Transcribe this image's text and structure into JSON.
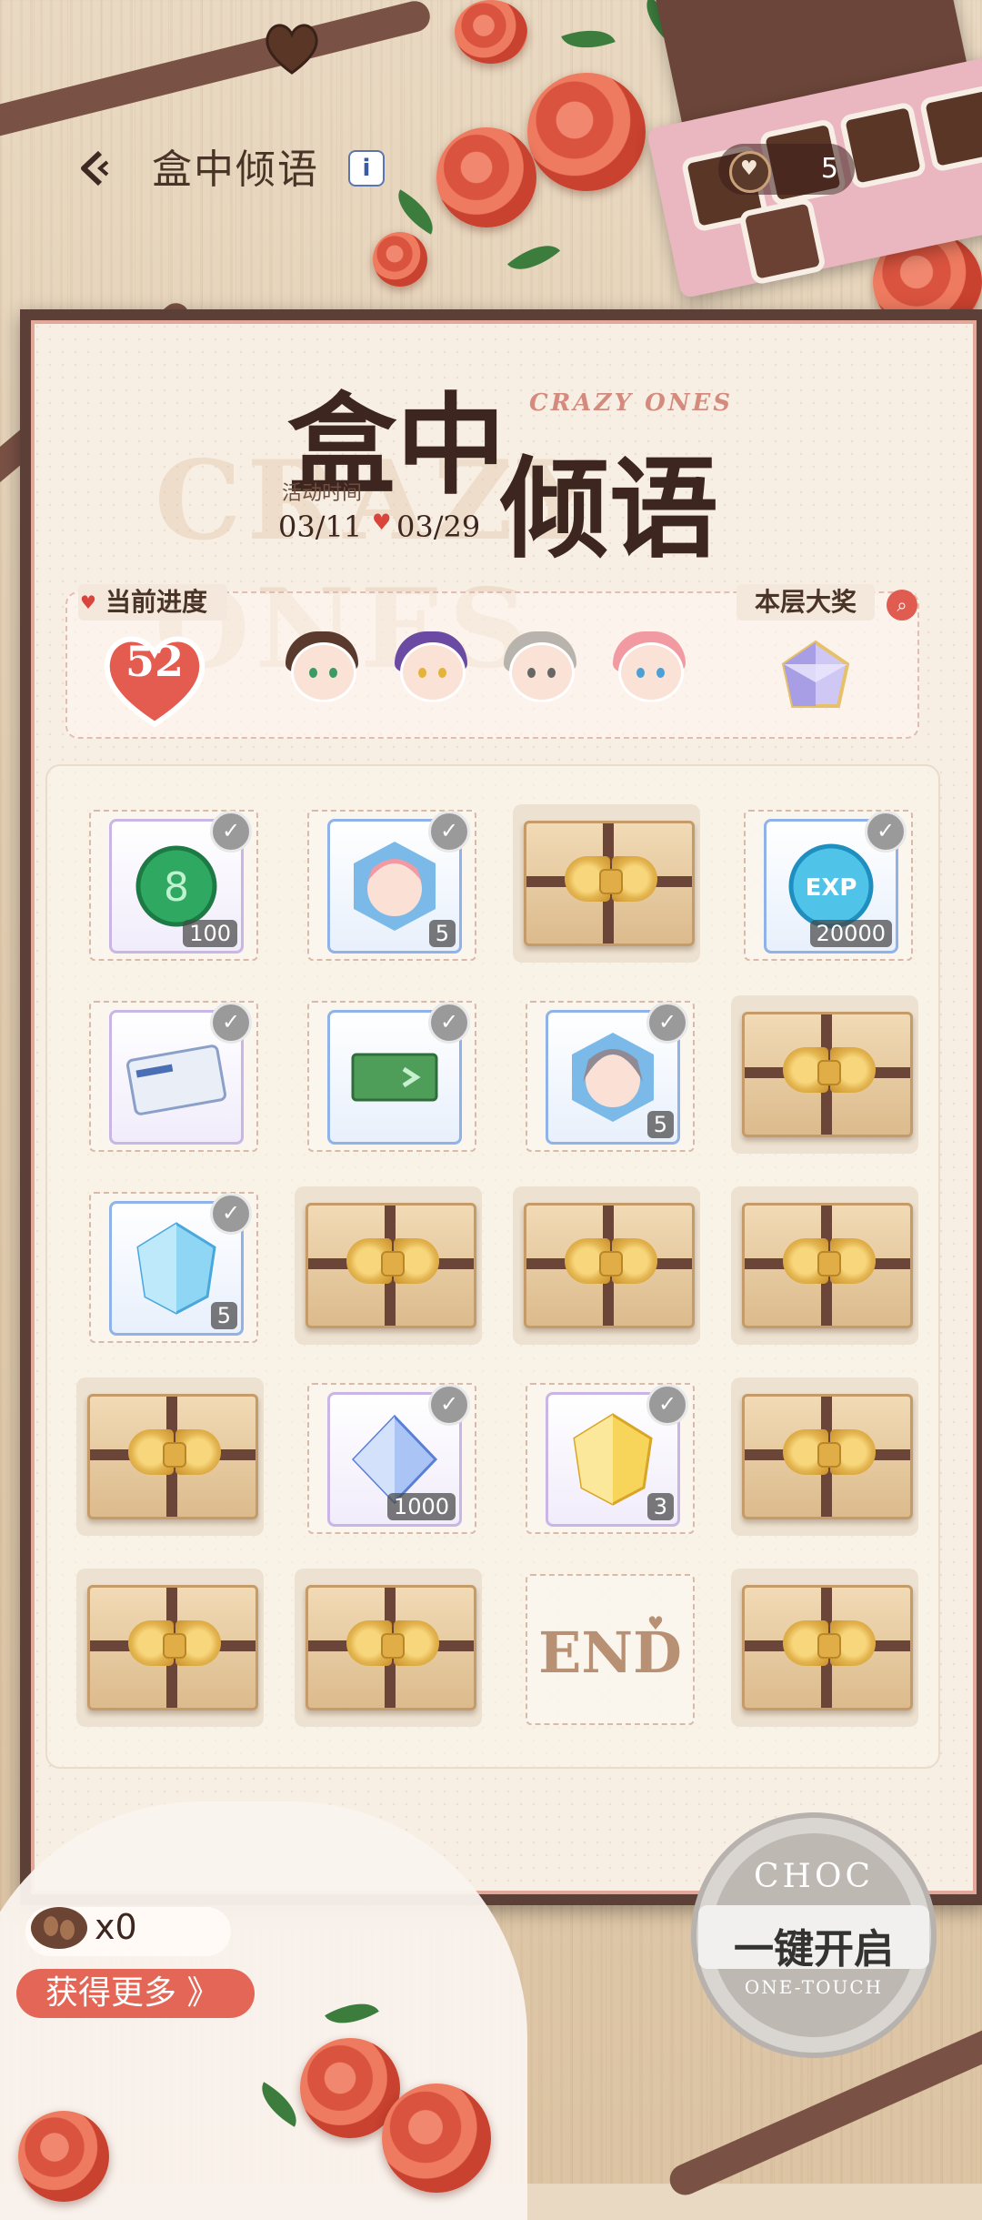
{
  "header": {
    "title": "盒中倾语",
    "info_icon": "i",
    "currency_count": "5"
  },
  "event": {
    "logo_line1": "盒中",
    "logo_line2": "倾语",
    "subtitle": "CRAZY ONES",
    "background_text": "CRAZY ONES",
    "period_label": "活动时间",
    "start_date": "03/11",
    "end_date": "03/29"
  },
  "progress": {
    "label": "当前进度",
    "value": "52",
    "grand_prize_label": "本层大奖"
  },
  "grid": {
    "cells": [
      {
        "state": "claimed",
        "item": "green-coin",
        "qty": "100"
      },
      {
        "state": "claimed",
        "item": "pink-character-shard",
        "qty": "5"
      },
      {
        "state": "closed"
      },
      {
        "state": "claimed",
        "item": "exp-coin",
        "qty": "20000"
      },
      {
        "state": "claimed",
        "item": "pass-card",
        "qty": ""
      },
      {
        "state": "claimed",
        "item": "green-ticket",
        "qty": ""
      },
      {
        "state": "claimed",
        "item": "silver-character-shard",
        "qty": "5"
      },
      {
        "state": "closed"
      },
      {
        "state": "claimed",
        "item": "blue-crystal",
        "qty": "5"
      },
      {
        "state": "closed"
      },
      {
        "state": "closed"
      },
      {
        "state": "closed"
      },
      {
        "state": "closed"
      },
      {
        "state": "claimed",
        "item": "diamond",
        "qty": "1000"
      },
      {
        "state": "claimed",
        "item": "gold-crystal",
        "qty": "3"
      },
      {
        "state": "closed"
      },
      {
        "state": "closed"
      },
      {
        "state": "closed"
      },
      {
        "state": "end",
        "label": "END"
      },
      {
        "state": "closed"
      }
    ]
  },
  "bottom": {
    "chocolate_count": "x0",
    "get_more_label": "获得更多 》",
    "seal_top": "CHOC",
    "one_key_open": "一键开启",
    "seal_bottom": "ONE-TOUCH"
  },
  "colors": {
    "accent": "#e46657",
    "frame": "#5c3f37",
    "checked": "#9a9a9a"
  }
}
